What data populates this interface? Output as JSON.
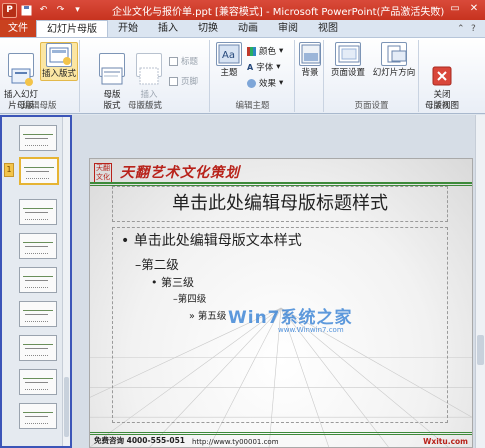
{
  "window": {
    "title": "企业文化与报价单.ppt [兼容模式] - Microsoft PowerPoint(产品激活失败)",
    "app_icon": "P",
    "controls": [
      "—",
      "▭",
      "✕"
    ]
  },
  "quick_access": {
    "save_icon": "save-icon",
    "undo_icon": "undo-icon",
    "redo_icon": "redo-icon"
  },
  "tabs": [
    "文件",
    "幻灯片母版",
    "开始",
    "插入",
    "切换",
    "动画",
    "审阅",
    "视图"
  ],
  "active_tab": "幻灯片母版",
  "ribbon": {
    "groups": {
      "edit_master": {
        "label": "编辑母版",
        "insert_master": "插入幻灯\n片母版",
        "insert_layout": "插入版式"
      },
      "master_layout": {
        "label": "母版版式",
        "master_layout_btn": "母版\n版式",
        "insert_placeholder": "插入\n占位符",
        "title_check": "标题",
        "footer_check": "页脚"
      },
      "edit_theme": {
        "label": "编辑主题",
        "themes": "主题",
        "colors": "颜色",
        "fonts": "字体",
        "effects": "效果"
      },
      "background": {
        "label": "背景",
        "background_btn": "背景"
      },
      "page_setup": {
        "label": "页面设置",
        "page_setup_btn": "页面设置",
        "orientation": "幻灯片方向"
      },
      "close": {
        "label": "关闭",
        "close_btn": "关闭\n母版视图"
      }
    }
  },
  "slide": {
    "brand": "天翻艺术文化策划",
    "logo": "天翻\n文化",
    "title_placeholder": "单击此处编辑母版标题样式",
    "body": {
      "level1": "• 单击此处编辑母版文本样式",
      "level2": "–第二级",
      "level3": "• 第三级",
      "level4": "–第四级",
      "level5": "» 第五级"
    },
    "footer_left": "免费咨询 4000-555-051",
    "footer_mid": "http://www.ty00001.com",
    "footer_right": "Wxitu.com"
  },
  "watermark": {
    "text": "Win7系统之家",
    "sub": "www.Winwin7.com"
  },
  "thumbnails": {
    "count": 11,
    "master_marker": "1"
  },
  "colors": {
    "accent_red": "#c7331f",
    "brand_red": "#b8221a",
    "green_rule": "#3d8a3a",
    "panel_border": "#3c55b8"
  }
}
